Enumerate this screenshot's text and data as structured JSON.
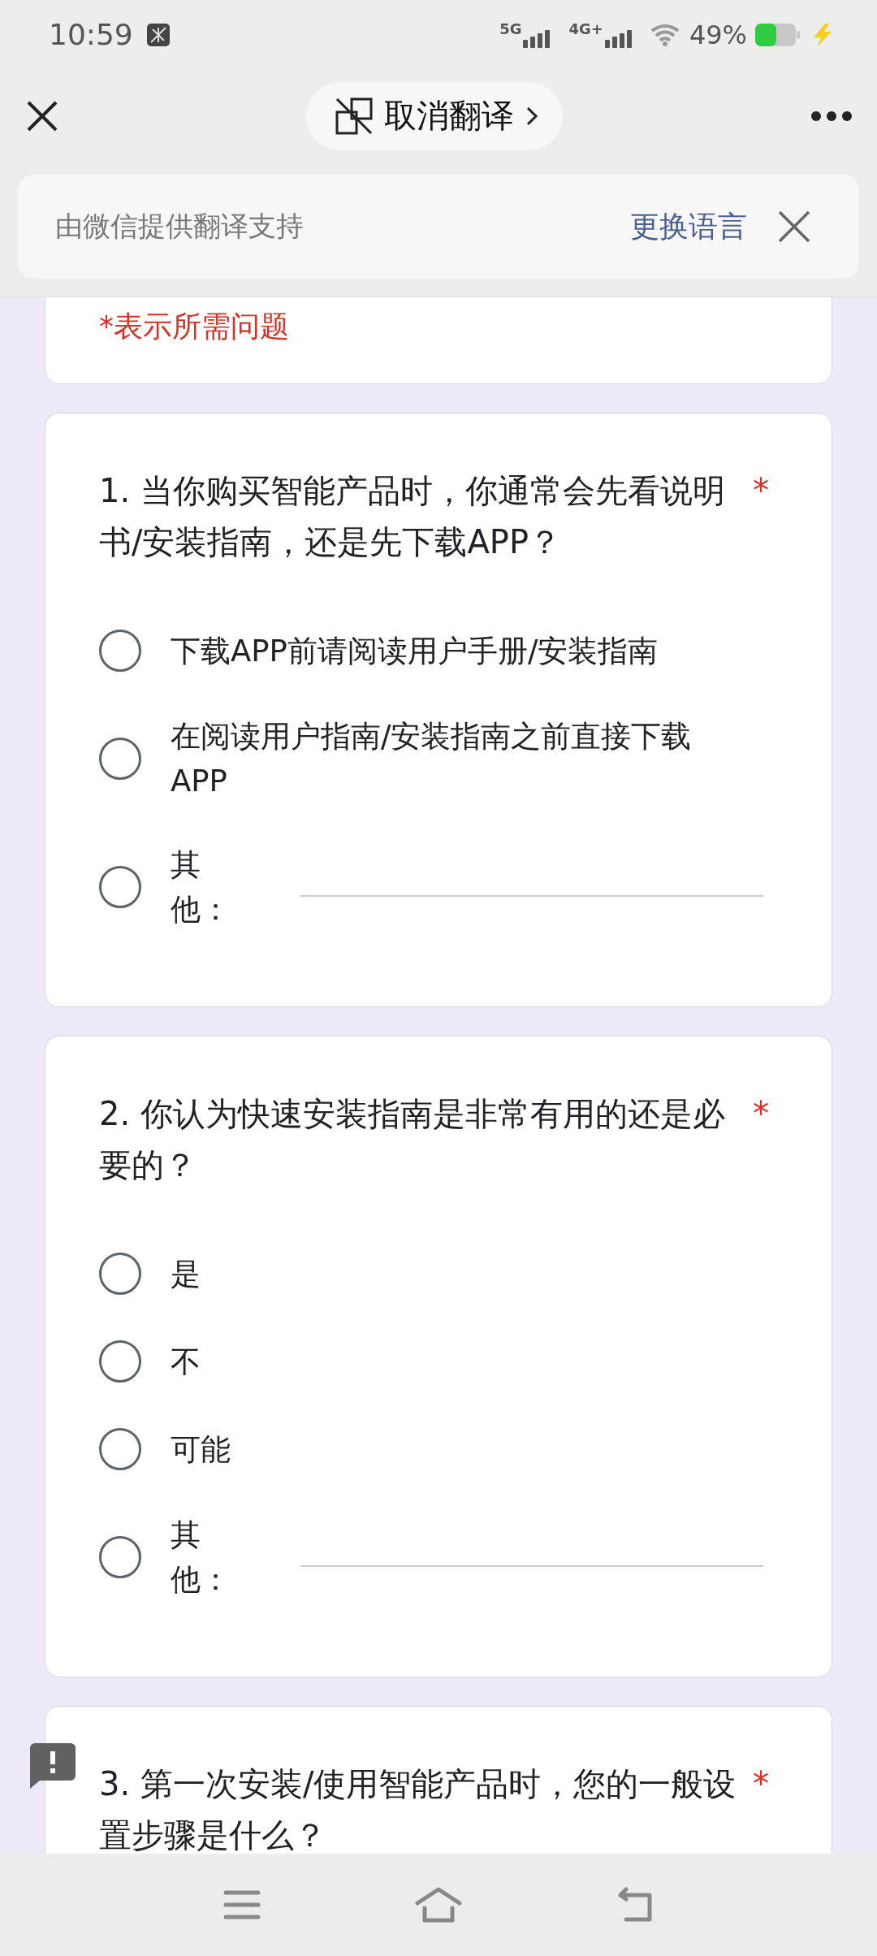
{
  "status_bar": {
    "time": "10:59",
    "network_1": "5G",
    "network_2": "4G+",
    "battery": "49%"
  },
  "top_bar": {
    "translate_button": "取消翻译"
  },
  "translate_banner": {
    "text": "由微信提供翻译支持",
    "link": "更换语言"
  },
  "form": {
    "required_note": "*表示所需问题",
    "questions": [
      {
        "title": "1. 当你购买智能产品时，你通常会先看说明书/安装指南，还是先下载APP？",
        "required_mark": "*",
        "options": [
          {
            "kind": "radio",
            "label": "下载APP前请阅读用户手册/安装指南",
            "selected": false
          },
          {
            "kind": "radio",
            "label": "在阅读用户指南/安装指南之前直接下载APP",
            "selected": false
          },
          {
            "kind": "other",
            "label": "其他：",
            "selected": false
          }
        ]
      },
      {
        "title": "2. 你认为快速安装指南是非常有用的还是必要的？",
        "required_mark": "*",
        "options": [
          {
            "kind": "radio",
            "label": "是",
            "selected": false
          },
          {
            "kind": "radio",
            "label": "不",
            "selected": false
          },
          {
            "kind": "radio",
            "label": "可能",
            "selected": false
          },
          {
            "kind": "other",
            "label": "其他：",
            "selected": false
          }
        ]
      },
      {
        "title": "3. 第一次安装/使用智能产品时，您的一般设置步骤是什么？",
        "required_mark": "*"
      }
    ]
  }
}
